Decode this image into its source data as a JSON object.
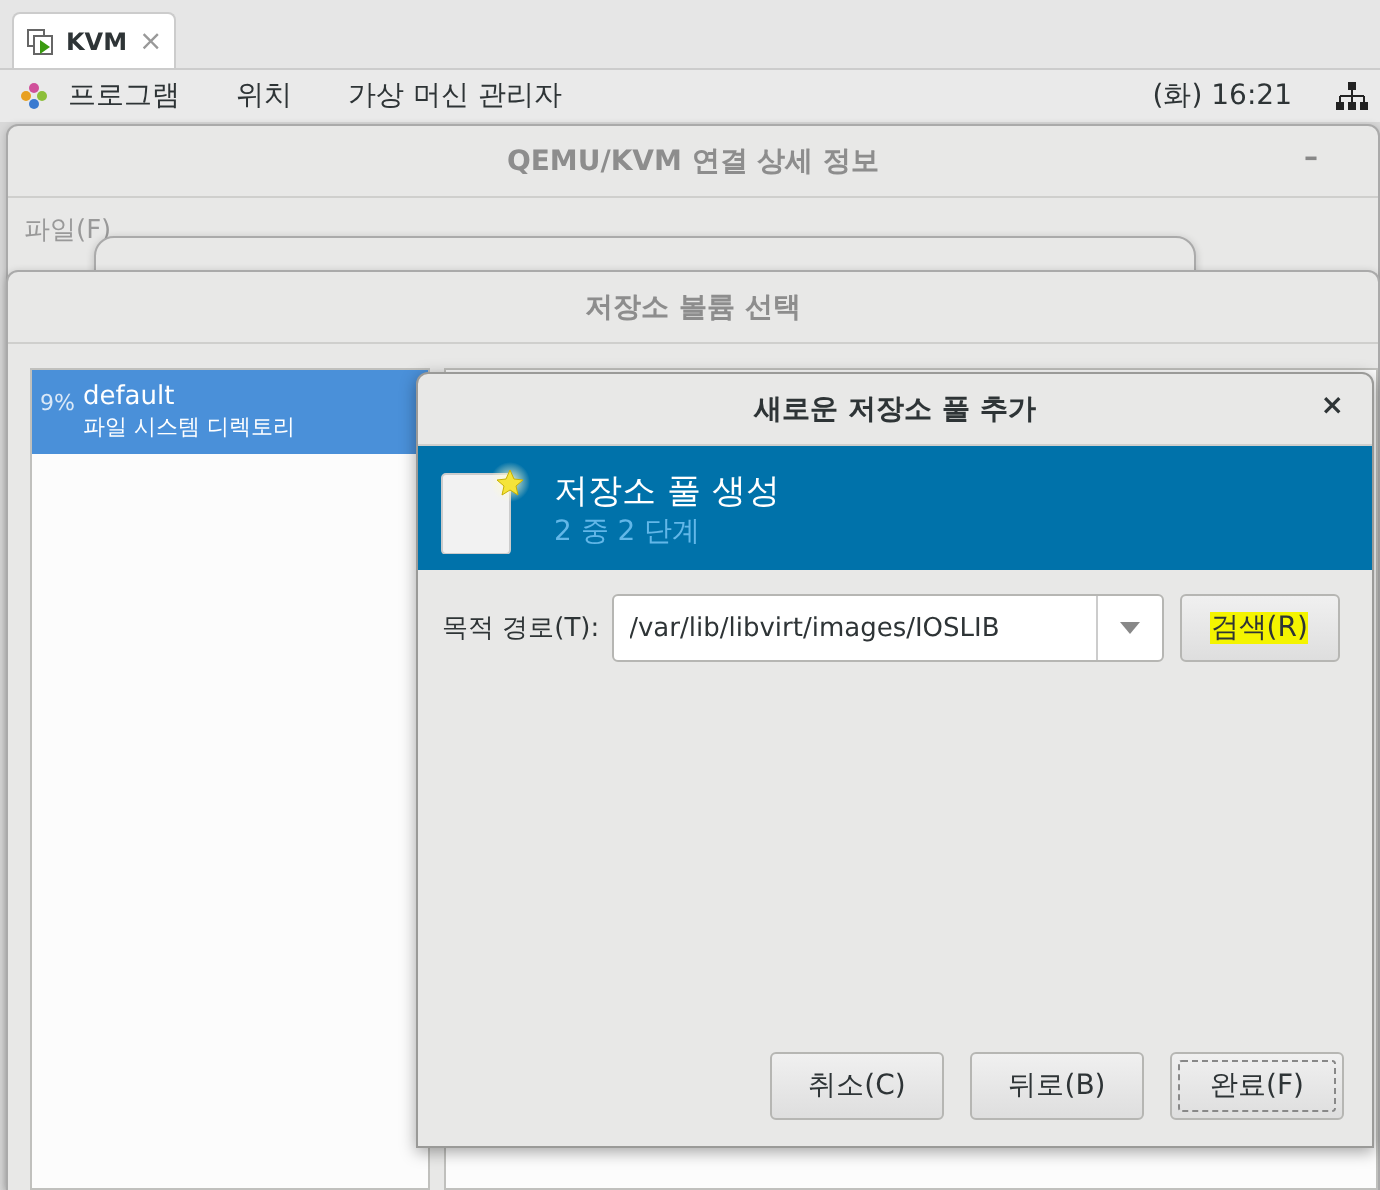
{
  "browser_tab": {
    "title": "KVM",
    "close": "×"
  },
  "top_panel": {
    "menus": [
      "프로그램",
      "위치",
      "가상 머신 관리자"
    ],
    "clock": "(화) 16:21"
  },
  "details_window": {
    "title": "QEMU/KVM 연결 상세 정보",
    "minimize": "–",
    "menu": [
      "파일(F)"
    ]
  },
  "volume_window": {
    "title": "저장소 볼륨 선택",
    "pools": [
      {
        "usage": "9%",
        "name": "default",
        "type": "파일 시스템 디렉토리",
        "selected": true
      }
    ]
  },
  "dialog": {
    "title": "새로운 저장소 풀 추가",
    "close": "×",
    "header": {
      "title": "저장소 풀 생성",
      "step": "2 중 2 단계"
    },
    "target_label": "목적 경로(T):",
    "target_value": "/var/lib/libvirt/images/IOSLIB",
    "browse": {
      "label": "검색(R)",
      "highlighted": true
    },
    "buttons": [
      {
        "label": "취소(C)",
        "focused": false
      },
      {
        "label": "뒤로(B)",
        "focused": false
      },
      {
        "label": "완료(F)",
        "focused": true
      }
    ]
  }
}
